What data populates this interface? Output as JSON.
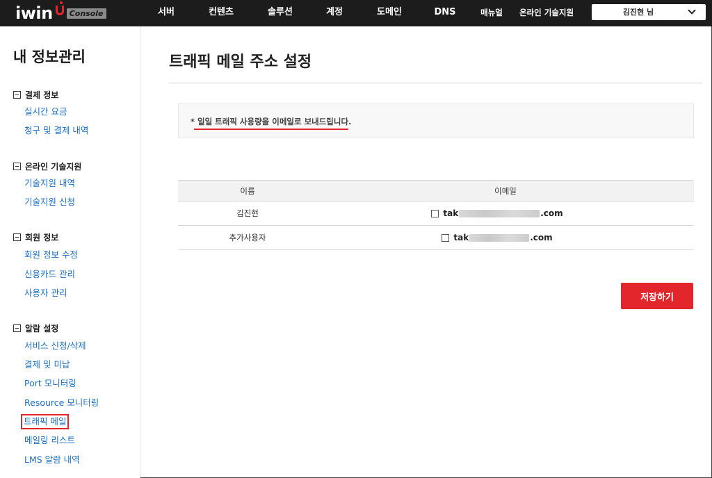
{
  "header": {
    "logo_text": "iwin",
    "console_badge": "Console",
    "nav": [
      {
        "label": "서버"
      },
      {
        "label": "컨텐츠"
      },
      {
        "label": "솔루션"
      },
      {
        "label": "계정"
      },
      {
        "label": "도메인"
      },
      {
        "label": "DNS"
      },
      {
        "label": "매뉴얼"
      },
      {
        "label": "온라인 기술지원"
      }
    ],
    "user_label": "김진현 님"
  },
  "sidebar": {
    "title": "내 정보관리",
    "groups": [
      {
        "title": "결제 정보",
        "items": [
          "실시간 요금",
          "청구 및 결제 내역"
        ]
      },
      {
        "title": "온라인 기술지원",
        "items": [
          "기술지원 내역",
          "기술지원 신청"
        ]
      },
      {
        "title": "회원 정보",
        "items": [
          "회원 정보 수정",
          "신용카드 관리",
          "사용자 관리"
        ]
      },
      {
        "title": "알람 설정",
        "items": [
          "서비스 신청/삭제",
          "결제 및 미납",
          "Port 모니터링",
          "Resource 모니터링",
          "트래픽 메일",
          "메일링 리스트",
          "LMS 알람 내역"
        ]
      }
    ],
    "active_item": "트래픽 메일"
  },
  "main": {
    "title": "트래픽 메일 주소 설정",
    "notice": "* 일일 트래픽 사용량을 이메일로 보내드립니다.",
    "table": {
      "headers": [
        "이름",
        "이메일"
      ],
      "rows": [
        {
          "name": "김진현",
          "email_prefix": "tak",
          "email_suffix": ".com",
          "checked": false
        },
        {
          "name": "추가사용자",
          "email_prefix": "tak",
          "email_suffix": ".com",
          "checked": false
        }
      ]
    },
    "save_label": "저장하기"
  },
  "colors": {
    "accent": "#e3262b",
    "topbar": "#1c1c1c",
    "link": "#1c6fc2"
  }
}
